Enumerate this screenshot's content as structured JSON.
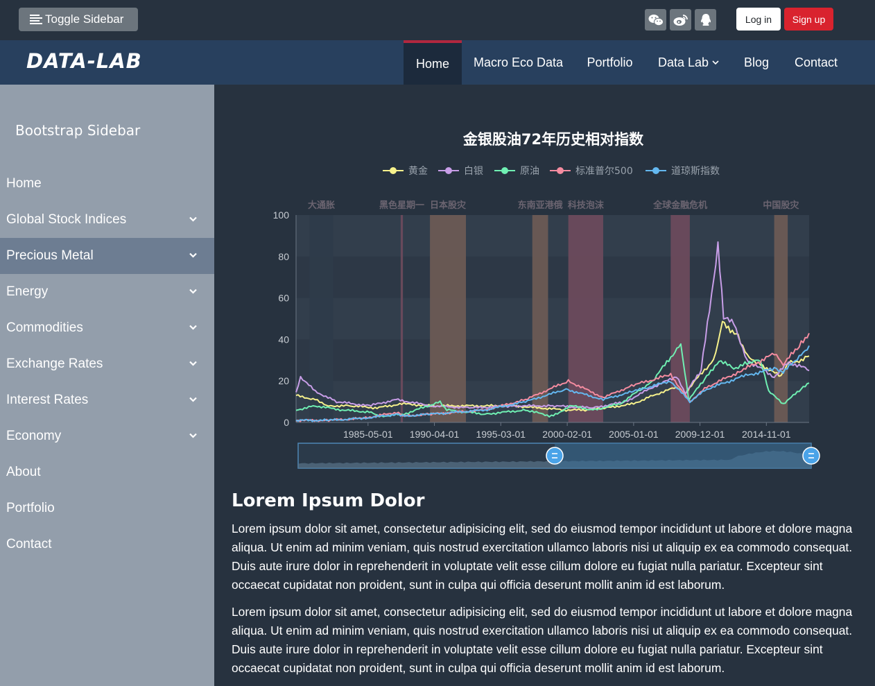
{
  "topbar": {
    "toggle_label": "Toggle Sidebar",
    "social_icons": [
      "wechat-icon",
      "weibo-icon",
      "qq-icon"
    ],
    "login_label": "Log in",
    "signup_label": "Sign up"
  },
  "navbar": {
    "logo": "DATA-LAB",
    "items": [
      "Home",
      "Macro Eco Data",
      "Portfolio",
      "Data Lab",
      "Blog",
      "Contact"
    ],
    "active": "Home"
  },
  "sidebar": {
    "title": "Bootstrap Sidebar",
    "items": [
      {
        "label": "Home",
        "has_submenu": false
      },
      {
        "label": "Global Stock Indices",
        "has_submenu": true
      },
      {
        "label": "Precious Metal",
        "has_submenu": true
      },
      {
        "label": "Energy",
        "has_submenu": true
      },
      {
        "label": "Commodities",
        "has_submenu": true
      },
      {
        "label": "Exchange Rates",
        "has_submenu": true
      },
      {
        "label": "Interest Rates",
        "has_submenu": true
      },
      {
        "label": "Economy",
        "has_submenu": true
      },
      {
        "label": "About",
        "has_submenu": false
      },
      {
        "label": "Portfolio",
        "has_submenu": false
      },
      {
        "label": "Contact",
        "has_submenu": false
      }
    ],
    "active": "Precious Metal"
  },
  "colors": {
    "accent_red": "#d9232e",
    "nav_bg": "#28405e",
    "sidebar_bg": "#939eab",
    "page_bg": "#27323f"
  },
  "chart_data": {
    "type": "line",
    "title": "金银股油72年历史相对指数",
    "ylim": [
      0,
      100
    ],
    "yticks": [
      0,
      20,
      40,
      60,
      80,
      100
    ],
    "x_start": "1980-01-01",
    "x_end": "2018-01-01",
    "xtick_labels": [
      "1985-05-01",
      "1990-04-01",
      "1995-03-01",
      "2000-02-01",
      "2005-01-01",
      "2009-12-01",
      "2014-11-01"
    ],
    "legend": [
      {
        "name": "黄金",
        "color": "#f7f28c"
      },
      {
        "name": "白银",
        "color": "#c89ee8"
      },
      {
        "name": "原油",
        "color": "#70f0b3"
      },
      {
        "name": "标准普尔500",
        "color": "#f58ca0"
      },
      {
        "name": "道琼斯指数",
        "color": "#64b8f0"
      }
    ],
    "events": [
      {
        "label": "大通胀",
        "start": "1981-01-01",
        "end": "1982-10-01",
        "color": "#2e3b4a"
      },
      {
        "label": "黑色星期一",
        "start": "1987-10-01",
        "end": "1987-12-01",
        "color": "#6c4a5c"
      },
      {
        "label": "日本股灾",
        "start": "1989-12-01",
        "end": "1992-08-01",
        "color": "#6c5a54"
      },
      {
        "label": "东南亚港俄",
        "start": "1997-07-01",
        "end": "1998-09-01",
        "color": "#6c5a54"
      },
      {
        "label": "科技泡沫",
        "start": "2000-03-01",
        "end": "2002-10-01",
        "color": "#6c4a5c"
      },
      {
        "label": "全球金融危机",
        "start": "2007-10-01",
        "end": "2009-03-01",
        "color": "#6c4a5c"
      },
      {
        "label": "中国股灾",
        "start": "2015-06-01",
        "end": "2016-06-01",
        "color": "#6c5a54"
      }
    ],
    "series": [
      {
        "name": "黄金",
        "x": [
          "1980-01-01",
          "1981-06-01",
          "1982-06-01",
          "1984-01-01",
          "1986-01-01",
          "1987-11-01",
          "1990-01-01",
          "1992-01-01",
          "1994-01-01",
          "1996-01-01",
          "1998-01-01",
          "2000-01-01",
          "2001-06-01",
          "2003-01-01",
          "2005-01-01",
          "2006-06-01",
          "2008-03-01",
          "2008-11-01",
          "2009-12-01",
          "2010-12-01",
          "2011-08-01",
          "2012-10-01",
          "2013-06-01",
          "2014-06-01",
          "2015-12-01",
          "2016-07-01",
          "2017-06-01",
          "2018-01-01"
        ],
        "y": [
          13,
          11,
          8,
          8,
          7,
          9,
          8,
          8,
          8,
          8,
          7,
          6,
          6,
          7,
          9,
          13,
          17,
          14,
          23,
          30,
          48,
          42,
          32,
          28,
          22,
          29,
          30,
          32
        ]
      },
      {
        "name": "白银",
        "x": [
          "1980-01-01",
          "1980-05-01",
          "1981-06-01",
          "1983-01-01",
          "1985-06-01",
          "1987-06-01",
          "1990-01-01",
          "1993-01-01",
          "1996-01-01",
          "1999-01-01",
          "2002-01-01",
          "2004-06-01",
          "2006-06-01",
          "2008-03-01",
          "2008-11-01",
          "2010-01-01",
          "2011-04-01",
          "2011-09-01",
          "2012-06-01",
          "2013-06-01",
          "2015-06-01",
          "2016-07-01",
          "2017-06-01",
          "2018-01-01"
        ],
        "y": [
          14,
          22,
          15,
          10,
          8,
          11,
          8,
          7,
          8,
          8,
          7,
          10,
          17,
          22,
          14,
          25,
          85,
          50,
          48,
          30,
          22,
          29,
          27,
          25
        ]
      },
      {
        "name": "原油",
        "x": [
          "1980-01-01",
          "1981-06-01",
          "1983-06-01",
          "1985-06-01",
          "1986-03-01",
          "1988-01-01",
          "1990-09-01",
          "1991-03-01",
          "1994-01-01",
          "1997-01-01",
          "1998-12-01",
          "2000-06-01",
          "2002-01-01",
          "2004-01-01",
          "2006-06-01",
          "2008-07-01",
          "2009-02-01",
          "2010-06-01",
          "2011-05-01",
          "2012-06-01",
          "2013-06-01",
          "2014-06-01",
          "2015-01-01",
          "2016-02-01",
          "2017-06-01",
          "2018-01-01"
        ],
        "y": [
          6,
          8,
          6,
          5,
          3,
          4,
          10,
          6,
          4,
          6,
          3,
          8,
          6,
          9,
          20,
          38,
          11,
          22,
          30,
          26,
          29,
          30,
          15,
          9,
          16,
          19
        ]
      },
      {
        "name": "标准普尔500",
        "x": [
          "1980-01-01",
          "1982-06-01",
          "1985-01-01",
          "1987-08-01",
          "1987-12-01",
          "1990-01-01",
          "1994-01-01",
          "1997-01-01",
          "2000-03-01",
          "2002-10-01",
          "2005-01-01",
          "2007-10-01",
          "2009-03-01",
          "2010-06-01",
          "2013-01-01",
          "2015-06-01",
          "2016-02-01",
          "2017-06-01",
          "2018-01-01"
        ],
        "y": [
          1,
          1,
          2,
          5,
          3,
          4,
          6,
          11,
          20,
          12,
          18,
          23,
          10,
          17,
          25,
          33,
          28,
          38,
          43
        ]
      },
      {
        "name": "道琼斯指数",
        "x": [
          "1980-01-01",
          "1982-06-01",
          "1985-01-01",
          "1987-08-01",
          "1987-12-01",
          "1990-01-01",
          "1994-01-01",
          "1997-01-01",
          "2000-01-01",
          "2002-10-01",
          "2005-01-01",
          "2007-10-01",
          "2009-03-01",
          "2010-06-01",
          "2013-01-01",
          "2015-06-01",
          "2016-02-01",
          "2017-06-01",
          "2018-01-01"
        ],
        "y": [
          1,
          1,
          2,
          4,
          3,
          4,
          6,
          10,
          16,
          11,
          15,
          20,
          10,
          16,
          22,
          26,
          24,
          33,
          37
        ]
      }
    ]
  },
  "content": {
    "title": "Lorem Ipsum Dolor",
    "paragraphs": [
      "Lorem ipsum dolor sit amet, consectetur adipisicing elit, sed do eiusmod tempor incididunt ut labore et dolore magna aliqua. Ut enim ad minim veniam, quis nostrud exercitation ullamco laboris nisi ut aliquip ex ea commodo consequat. Duis aute irure dolor in reprehenderit in voluptate velit esse cillum dolore eu fugiat nulla pariatur. Excepteur sint occaecat cupidatat non proident, sunt in culpa qui officia deserunt mollit anim id est laborum.",
      "Lorem ipsum dolor sit amet, consectetur adipisicing elit, sed do eiusmod tempor incididunt ut labore et dolore magna aliqua. Ut enim ad minim veniam, quis nostrud exercitation ullamco laboris nisi ut aliquip ex ea commodo consequat. Duis aute irure dolor in reprehenderit in voluptate velit esse cillum dolore eu fugiat nulla pariatur. Excepteur sint occaecat cupidatat non proident, sunt in culpa qui officia deserunt mollit anim id est laborum."
    ]
  }
}
